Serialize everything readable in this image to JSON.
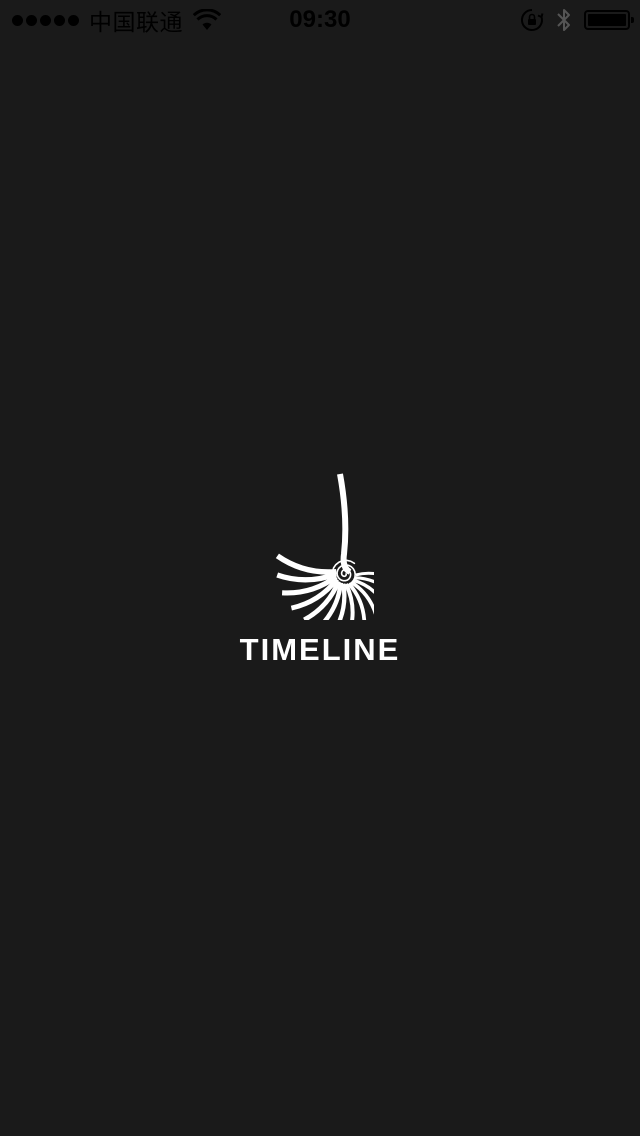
{
  "status_bar": {
    "carrier": "中国联通",
    "time": "09:30",
    "signal_bars": 5,
    "battery_level": 1.0,
    "icons": [
      "signal-dots-icon",
      "wifi-icon",
      "orientation-lock-icon",
      "bluetooth-icon",
      "battery-icon"
    ]
  },
  "splash": {
    "logo_icon": "nautilus-shell-icon",
    "brand_name": "TIMELINE"
  },
  "colors": {
    "background": "#1a1a1a",
    "foreground": "#ffffff",
    "status_text": "#000000"
  }
}
